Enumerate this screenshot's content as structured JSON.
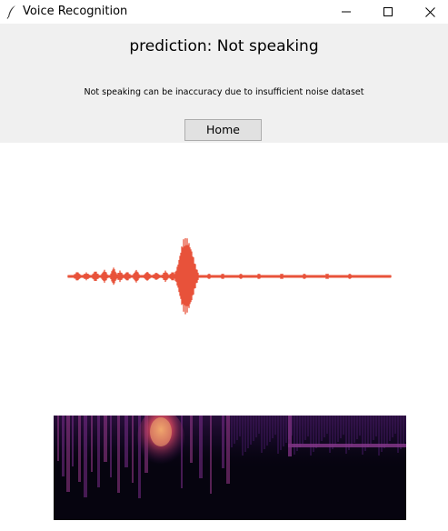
{
  "window": {
    "title": "Voice Recognition",
    "app_icon": "feather-icon",
    "controls": [
      "minimize-icon",
      "maximize-icon",
      "close-icon"
    ]
  },
  "header": {
    "prediction_text": "prediction: Not speaking",
    "note_text": "Not speaking can be inaccuracy due to insufficient noise dataset",
    "home_button_label": "Home"
  },
  "colors": {
    "panel_bg": "#f0f0f0",
    "waveform": "#e8533a",
    "spectrogram_dark": "#06040f",
    "spectrogram_hot": "#f5a46a"
  }
}
